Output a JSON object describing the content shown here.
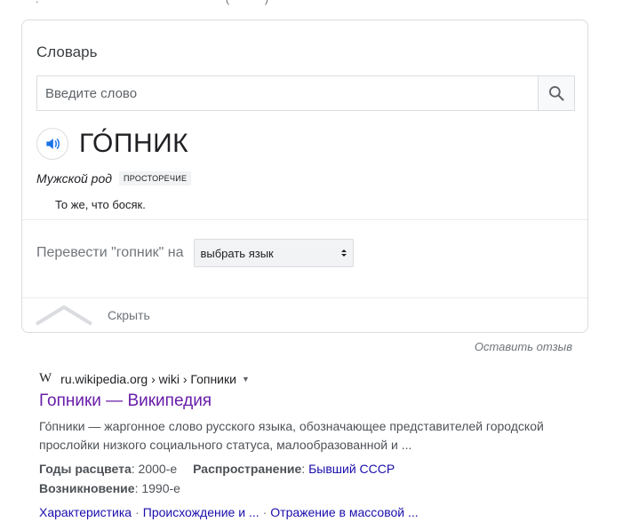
{
  "dictionary": {
    "title": "Словарь",
    "search_placeholder": "Введите слово",
    "headword": "го́пник",
    "gender": "Мужской род",
    "register_label": "ПРОСТОРЕЧИЕ",
    "definition": "То же, что босяк.",
    "translate_label": "Перевести \"гопник\" на",
    "language_select": "выбрать язык",
    "collapse_label": "Скрыть"
  },
  "feedback_label": "Оставить отзыв",
  "result": {
    "site_logo": "W",
    "breadcrumb": "ru.wikipedia.org › wiki › Гопники",
    "title": "Гопники — Википедия",
    "snippet": "Го́пники — жаргонное слово русского языка, обозначающее представителей городской прослойки низкого социального статуса, малообразованной и ...",
    "facts": {
      "years_label": "Годы расцвета",
      "years_value": ": 2000-е",
      "spread_label": "Распространение",
      "spread_value": "Бывший СССР",
      "origin_label": "Возникновение",
      "origin_value": ": 1990-е"
    },
    "sitelinks": [
      "Характеристика",
      "Происхождение и ...",
      "Отражение в массовой ..."
    ]
  }
}
